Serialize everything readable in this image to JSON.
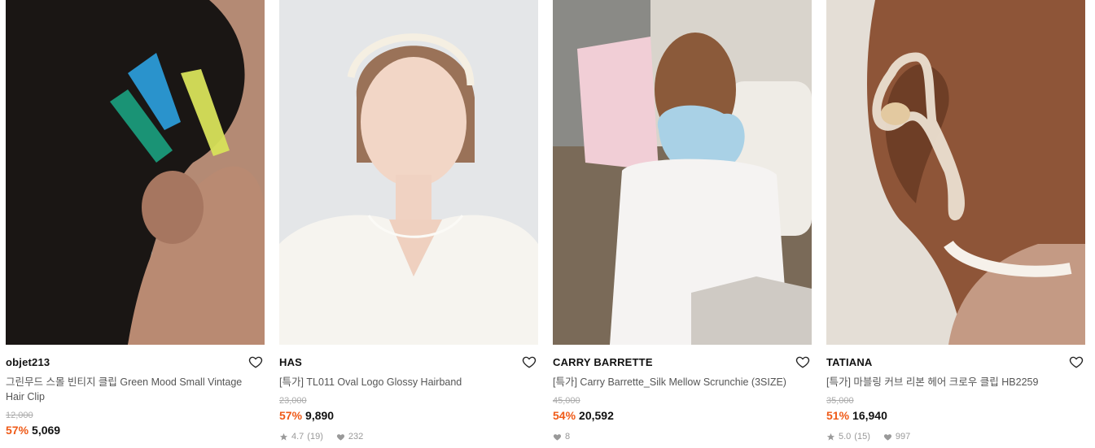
{
  "products": [
    {
      "brand": "objet213",
      "title": "그린무드 스몰 빈티지 클립 Green Mood Small Vintage Hair Clip",
      "original_price": "12,000",
      "discount": "57%",
      "price": "5,069",
      "rating": "",
      "review_count": "",
      "like_count": "",
      "image": "hair-clips-photo"
    },
    {
      "brand": "HAS",
      "title": "[특가] TL011 Oval Logo Glossy Hairband",
      "original_price": "23,000",
      "discount": "57%",
      "price": "9,890",
      "rating": "4.7",
      "review_count": "(19)",
      "like_count": "232",
      "image": "hairband-photo"
    },
    {
      "brand": "CARRY BARRETTE",
      "title": "[특가] Carry Barrette_Silk Mellow Scrunchie (3SIZE)",
      "original_price": "45,000",
      "discount": "54%",
      "price": "20,592",
      "rating": "",
      "review_count": "",
      "like_count": "8",
      "image": "scrunchie-photo"
    },
    {
      "brand": "TATIANA",
      "title": "[특가] 마블링 커브 리본 헤어 크로우 클립 HB2259",
      "original_price": "35,000",
      "discount": "51%",
      "price": "16,940",
      "rating": "5.0",
      "review_count": "(15)",
      "like_count": "997",
      "image": "claw-clip-photo"
    }
  ],
  "colors": {
    "discount": "#ef5a17",
    "price": "#111111",
    "muted": "#999999"
  }
}
